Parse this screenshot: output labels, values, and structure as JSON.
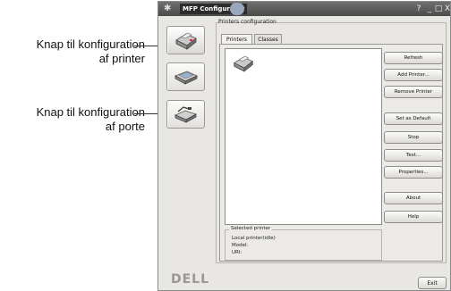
{
  "callouts": {
    "printer_config_button": "Knap til konfiguration\naf printer",
    "port_config_button": "Knap til konfiguration\naf porte"
  },
  "window": {
    "title": "MFP Configurator",
    "controls": {
      "help": "?",
      "minimize": "_",
      "maximize": "□",
      "close": "X"
    }
  },
  "nav": [
    {
      "icon": "printer-icon"
    },
    {
      "icon": "scanner-icon"
    },
    {
      "icon": "port-icon"
    }
  ],
  "printers_config": {
    "group_label": "Printers configuration",
    "tabs": [
      {
        "label": "Printers",
        "selected": true
      },
      {
        "label": "Classes",
        "selected": false
      }
    ],
    "actions": {
      "refresh": "Refresh",
      "add_printer": "Add Printer...",
      "remove_printer": "Remove Printer",
      "set_default": "Set as Default",
      "stop": "Stop",
      "test": "Test...",
      "properties": "Properties...",
      "about": "About",
      "help": "Help"
    },
    "selected_printer": {
      "title": "Selected printer",
      "line1": "Local printer(idle)",
      "line2": "Model:",
      "line3": "URI:"
    }
  },
  "footer": {
    "brand": "DELL",
    "exit": "Exit"
  }
}
